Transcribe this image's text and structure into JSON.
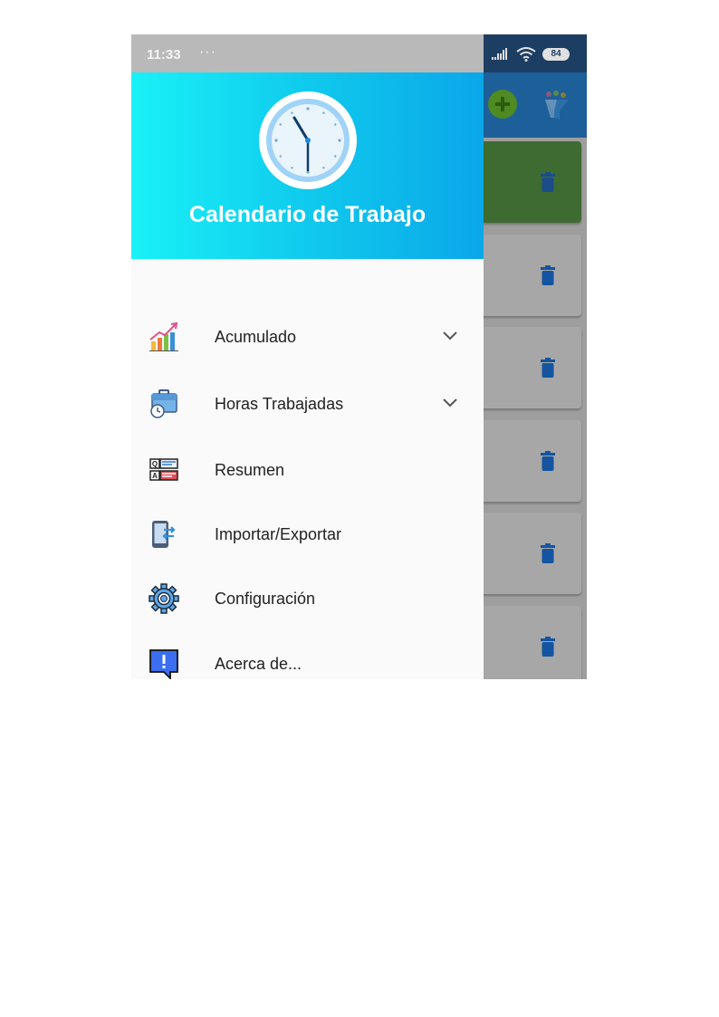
{
  "status_bar": {
    "time": "11:33",
    "dots": "···",
    "battery": "84"
  },
  "drawer": {
    "title": "Calendario de Trabajo",
    "items": [
      {
        "label": "Acumulado",
        "icon": "chart-growth-icon",
        "expandable": true
      },
      {
        "label": "Horas Trabajadas",
        "icon": "briefcase-clock-icon",
        "expandable": true
      },
      {
        "label": "Resumen",
        "icon": "qa-summary-icon",
        "expandable": false
      },
      {
        "label": "Importar/Exportar",
        "icon": "phone-transfer-icon",
        "expandable": false
      },
      {
        "label": "Configuración",
        "icon": "gear-icon",
        "expandable": false
      },
      {
        "label": "Acerca de...",
        "icon": "info-message-icon",
        "expandable": false
      }
    ]
  },
  "colors": {
    "header_gradient_start": "#19f1f7",
    "header_gradient_end": "#0aa7e9",
    "app_bar": "#1d5f98",
    "delete_icon": "#1565c0"
  }
}
